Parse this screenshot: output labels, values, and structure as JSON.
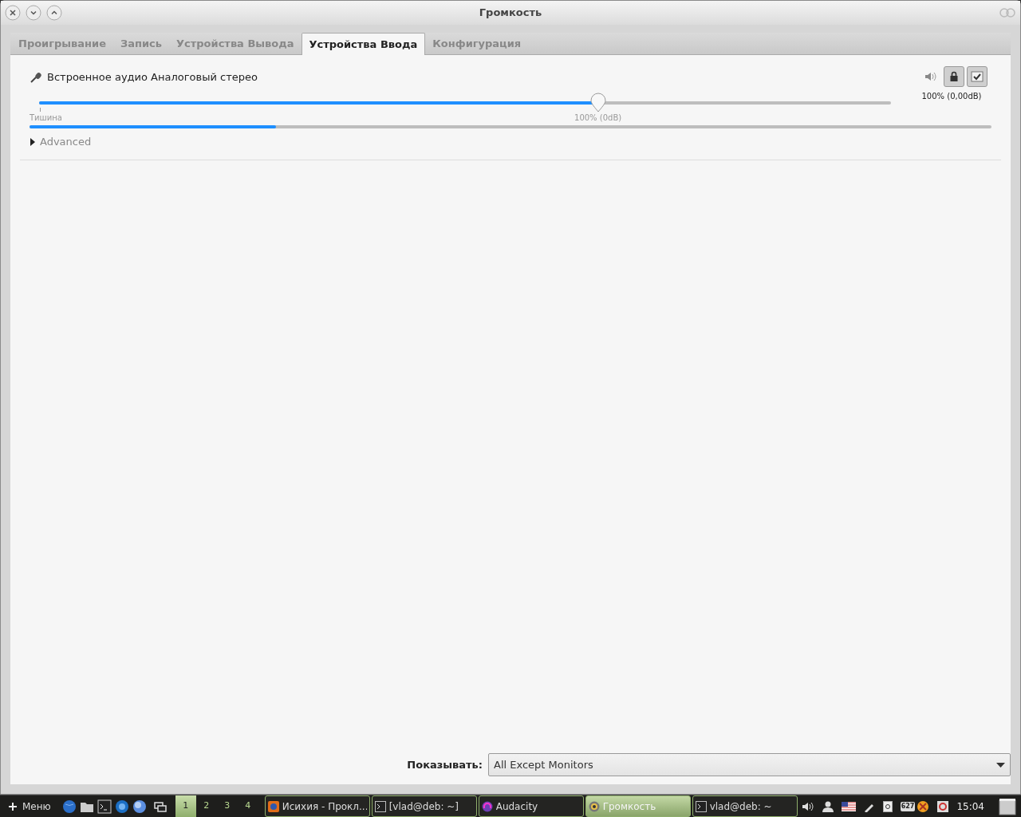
{
  "window": {
    "title": "Громкость"
  },
  "tabs": [
    {
      "label": "Проигрывание",
      "selected": false
    },
    {
      "label": "Запись",
      "selected": false
    },
    {
      "label": "Устройства Вывода",
      "selected": false
    },
    {
      "label": "Устройства Ввода",
      "selected": true
    },
    {
      "label": "Конфигурация",
      "selected": false
    }
  ],
  "device": {
    "name": "Встроенное аудио Аналоговый стерео",
    "locked": true,
    "fallback": true,
    "volume_reading": "100% (0,00dB)",
    "slider": {
      "level": 0.656,
      "min_label": "Тишина",
      "mark_label": "100% (0dB)"
    },
    "peak_meter": {
      "level": 0.256
    },
    "advanced": {
      "label": "Advanced",
      "expanded": false
    }
  },
  "show": {
    "label": "Показывать:",
    "value": "All Except Monitors"
  },
  "taskbar": {
    "menu_label": "Меню",
    "workspaces": [
      {
        "label": "1",
        "selected": true
      },
      {
        "label": "2",
        "selected": false
      },
      {
        "label": "3",
        "selected": false
      },
      {
        "label": "4",
        "selected": false
      }
    ],
    "tasks": [
      {
        "label": "Исихия - Прокл...",
        "kind": "browser",
        "selected": false
      },
      {
        "label": "[vlad@deb: ~]",
        "kind": "terminal",
        "selected": false
      },
      {
        "label": "Audacity",
        "kind": "audio",
        "selected": false
      },
      {
        "label": "Громкость",
        "kind": "volume",
        "selected": true
      },
      {
        "label": "vlad@deb: ~",
        "kind": "terminal",
        "selected": false
      }
    ],
    "tray_badge": "627",
    "clock": "15:04"
  }
}
